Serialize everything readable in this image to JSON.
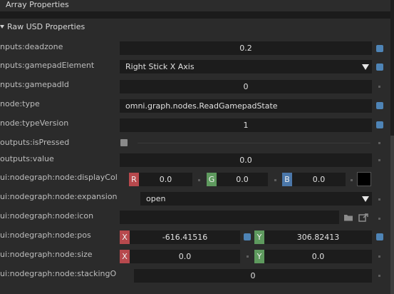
{
  "sections": {
    "array_properties": "Array Properties",
    "raw_usd": "Raw USD Properties"
  },
  "rows": {
    "deadzone": {
      "label": "nputs:deadzone",
      "value": "0.2"
    },
    "gamepad_element": {
      "label": "nputs:gamepadElement",
      "value": "Right Stick X Axis"
    },
    "gamepad_id": {
      "label": "nputs:gamepadId",
      "value": "0"
    },
    "node_type": {
      "label": "node:type",
      "value": "omni.graph.nodes.ReadGamepadState"
    },
    "node_type_version": {
      "label": "node:typeVersion",
      "value": "1"
    },
    "is_pressed": {
      "label": "outputs:isPressed"
    },
    "value": {
      "label": "outputs:value",
      "value": "0.0"
    },
    "display_color": {
      "label": "ui:nodegraph:node:displayColor",
      "r_tag": "R",
      "r": "0.0",
      "g_tag": "G",
      "g": "0.0",
      "b_tag": "B",
      "b": "0.0"
    },
    "expansion_state": {
      "label": "ui:nodegraph:node:expansionState",
      "value": "open"
    },
    "icon": {
      "label": "ui:nodegraph:node:icon",
      "value": ""
    },
    "pos": {
      "label": "ui:nodegraph:node:pos",
      "x_tag": "X",
      "x": "-616.41516",
      "y_tag": "Y",
      "y": "306.82413"
    },
    "size": {
      "label": "ui:nodegraph:node:size",
      "x_tag": "X",
      "x": "0.0",
      "y_tag": "Y",
      "y": "0.0"
    },
    "stacking_order": {
      "label": "ui:nodegraph:node:stackingOrder",
      "value": "0"
    }
  },
  "icons": [
    "chevron-down-icon",
    "dropdown-arrow-icon",
    "folder-icon",
    "open-file-icon",
    "checkbox-icon"
  ],
  "colors": {
    "indicator_blue": "#4e84b6",
    "swatch": "#000000",
    "r_tag": "#b7494d",
    "g_tag": "#5e9a5e",
    "b_tag": "#4b77a9"
  }
}
